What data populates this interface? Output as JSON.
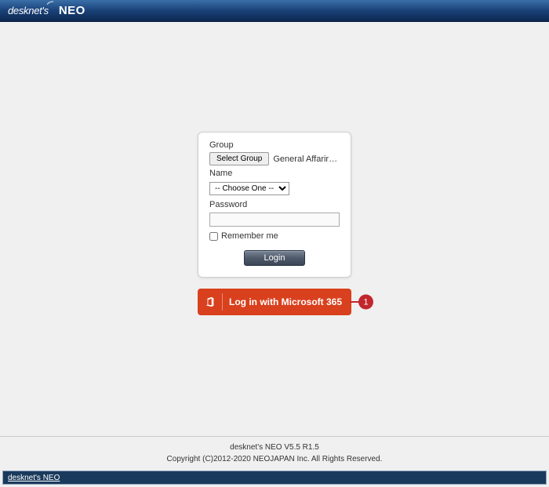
{
  "header": {
    "logo_part1": "desknet's",
    "logo_part2": "NEO"
  },
  "login": {
    "group_label": "Group",
    "select_group_button": "Select Group",
    "selected_group": "General Affarirs D...",
    "name_label": "Name",
    "name_placeholder": "-- Choose One --",
    "password_label": "Password",
    "password_value": "",
    "remember_label": "Remember me",
    "login_button": "Login"
  },
  "ms365": {
    "button_text": "Log in with Microsoft 365"
  },
  "annotation": {
    "badge_number": "1"
  },
  "footer": {
    "version": "desknet's NEO V5.5 R1.5",
    "copyright": "Copyright (C)2012-2020 NEOJAPAN Inc. All Rights Reserved.",
    "link_text": "desknet's NEO"
  }
}
